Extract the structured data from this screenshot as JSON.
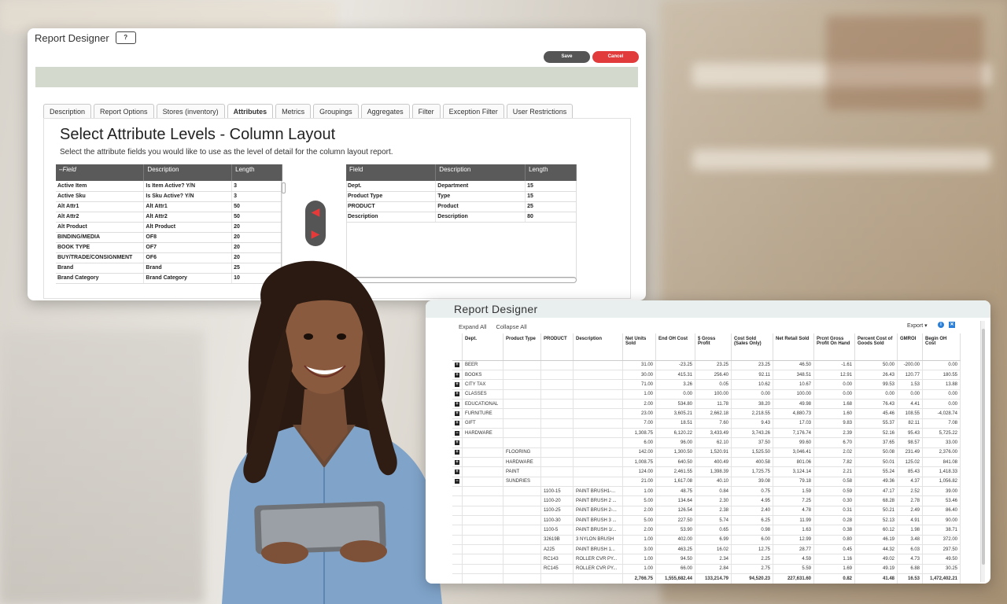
{
  "designer": {
    "title": "Report Designer",
    "help_label": "?",
    "save_label": "Save",
    "cancel_label": "Cancel",
    "tabs": [
      {
        "label": "Description"
      },
      {
        "label": "Report Options"
      },
      {
        "label": "Stores (inventory)"
      },
      {
        "label": "Attributes",
        "active": true
      },
      {
        "label": "Metrics"
      },
      {
        "label": "Groupings"
      },
      {
        "label": "Aggregates"
      },
      {
        "label": "Filter"
      },
      {
        "label": "Exception Filter"
      },
      {
        "label": "User Restrictions"
      }
    ],
    "heading": "Select Attribute Levels - Column Layout",
    "subheading": "Select the attribute fields you would like to use as the level of detail for the column layout report.",
    "available": {
      "columns": [
        "–Field",
        "Description",
        "Length"
      ],
      "rows": [
        [
          "Active Item",
          "Is Item Active? Y/N",
          "3"
        ],
        [
          "Active Sku",
          "Is Sku Active? Y/N",
          "3"
        ],
        [
          "Alt Attr1",
          "Alt Attr1",
          "50"
        ],
        [
          "Alt Attr2",
          "Alt Attr2",
          "50"
        ],
        [
          "Alt Product",
          "Alt Product",
          "20"
        ],
        [
          "BINDING/MEDIA",
          "OF8",
          "20"
        ],
        [
          "BOOK TYPE",
          "OF7",
          "20"
        ],
        [
          "BUY/TRADE/CONSIGNMENT",
          "OF6",
          "20"
        ],
        [
          "Brand",
          "Brand",
          "25"
        ],
        [
          "Brand Category",
          "Brand Category",
          "10"
        ]
      ]
    },
    "selected": {
      "columns": [
        "Field",
        "Description",
        "Length"
      ],
      "rows": [
        [
          "Dept.",
          "Department",
          "15"
        ],
        [
          "Product Type",
          "Type",
          "15"
        ],
        [
          "PRODUCT",
          "Product",
          "25"
        ],
        [
          "Description",
          "Description",
          "80"
        ]
      ]
    },
    "colors": {
      "save": "#555555",
      "cancel": "#e23b3b",
      "header_bar": "#d3d9cd",
      "arrow": "#e63a3a"
    }
  },
  "report": {
    "title": "Report Designer",
    "expand_all": "Expand All",
    "collapse_all": "Collapse All",
    "export_label": "Export ▾",
    "columns": [
      "Dept.",
      "Product Type",
      "PRODUCT",
      "Description",
      "Net Units Sold",
      "End OH Cost",
      "$ Gross Profit",
      "Cost Sold (Sales Only)",
      "Net Retail Sold",
      "Prcnt Gross Profit On Hand",
      "Percent Cost of Goods Sold",
      "GMROI",
      "Begin OH Cost"
    ],
    "rows": [
      {
        "tog": "+",
        "c": [
          "BEER",
          "",
          "",
          "",
          "31.00",
          "-23.25",
          "23.25",
          "23.25",
          "46.50",
          "-1.61",
          "50.00",
          "-200.00",
          "0.00"
        ]
      },
      {
        "tog": "+",
        "c": [
          "BOOKS",
          "",
          "",
          "",
          "30.00",
          "415.31",
          "256.40",
          "92.11",
          "348.51",
          "12.91",
          "26.43",
          "120.77",
          "180.55"
        ]
      },
      {
        "tog": "+",
        "c": [
          "CITY TAX",
          "",
          "",
          "",
          "71.00",
          "3.26",
          "0.05",
          "10.62",
          "10.67",
          "0.00",
          "99.53",
          "1.53",
          "13.88"
        ]
      },
      {
        "tog": "+",
        "c": [
          "CLASSES",
          "",
          "",
          "",
          "1.00",
          "0.00",
          "100.00",
          "0.00",
          "100.00",
          "0.00",
          "0.00",
          "0.00",
          "0.00"
        ]
      },
      {
        "tog": "+",
        "c": [
          "EDUCATIONAL",
          "",
          "",
          "",
          "2.00",
          "534.80",
          "11.78",
          "38.20",
          "49.98",
          "1.68",
          "76.43",
          "4.41",
          "0.00"
        ]
      },
      {
        "tog": "+",
        "c": [
          "FURNITURE",
          "",
          "",
          "",
          "23.00",
          "3,605.21",
          "2,662.18",
          "2,218.55",
          "4,880.73",
          "1.60",
          "45.46",
          "108.55",
          "-4,028.74"
        ]
      },
      {
        "tog": "+",
        "c": [
          "GIFT",
          "",
          "",
          "",
          "7.00",
          "18.51",
          "7.60",
          "9.43",
          "17.03",
          "9.83",
          "55.37",
          "82.11",
          "7.08"
        ]
      },
      {
        "tog": "−",
        "c": [
          "HARDWARE",
          "",
          "",
          "",
          "1,308.75",
          "6,120.22",
          "3,433.49",
          "3,743.26",
          "7,176.74",
          "2.39",
          "52.16",
          "95.43",
          "5,725.22"
        ]
      },
      {
        "tog": "+",
        "c": [
          "",
          "",
          "",
          "",
          "6.00",
          "96.00",
          "62.10",
          "37.50",
          "99.60",
          "6.70",
          "37.65",
          "98.57",
          "33.00"
        ]
      },
      {
        "tog": "+",
        "c": [
          "",
          "FLOORING",
          "",
          "",
          "142.00",
          "1,300.50",
          "1,520.91",
          "1,525.50",
          "3,046.41",
          "2.02",
          "50.08",
          "231.49",
          "2,376.00"
        ]
      },
      {
        "tog": "+",
        "c": [
          "",
          "HARDWARE",
          "",
          "",
          "1,008.75",
          "640.50",
          "400.49",
          "400.58",
          "801.06",
          "7.82",
          "50.01",
          "125.02",
          "841.08"
        ]
      },
      {
        "tog": "+",
        "c": [
          "",
          "PAINT",
          "",
          "",
          "124.00",
          "2,461.55",
          "1,398.39",
          "1,725.75",
          "3,124.14",
          "2.21",
          "55.24",
          "85.43",
          "1,418.33"
        ]
      },
      {
        "tog": "−",
        "c": [
          "",
          "SUNDRIES",
          "",
          "",
          "21.00",
          "1,617.08",
          "40.10",
          "39.08",
          "79.18",
          "0.58",
          "49.36",
          "4.37",
          "1,056.82"
        ]
      },
      {
        "tog": "",
        "c": [
          "",
          "",
          "1100-15",
          "PAINT BRUSH1-...",
          "1.00",
          "48.75",
          "0.84",
          "0.75",
          "1.59",
          "0.59",
          "47.17",
          "2.52",
          "39.00"
        ]
      },
      {
        "tog": "",
        "c": [
          "",
          "",
          "1100-20",
          "PAINT BRUSH 2 ...",
          "5.00",
          "134.64",
          "2.30",
          "4.95",
          "7.25",
          "0.30",
          "68.28",
          "2.78",
          "53.46"
        ]
      },
      {
        "tog": "",
        "c": [
          "",
          "",
          "1100-25",
          "PAINT BRUSH 2-...",
          "2.00",
          "126.54",
          "2.38",
          "2.40",
          "4.78",
          "0.31",
          "50.21",
          "2.49",
          "86.40"
        ]
      },
      {
        "tog": "",
        "c": [
          "",
          "",
          "1100-30",
          "PAINT BRUSH 3 ...",
          "5.00",
          "227.50",
          "5.74",
          "6.25",
          "11.99",
          "0.28",
          "52.13",
          "4.91",
          "90.00"
        ]
      },
      {
        "tog": "",
        "c": [
          "",
          "",
          "1100-5",
          "PAINT BRUSH 1/...",
          "2.00",
          "53.90",
          "0.65",
          "0.98",
          "1.63",
          "0.38",
          "60.12",
          "1.98",
          "38.71"
        ]
      },
      {
        "tog": "",
        "c": [
          "",
          "",
          "32619B",
          "3 NYLON BRUSH",
          "1.00",
          "402.00",
          "6.99",
          "6.00",
          "12.99",
          "0.80",
          "46.19",
          "3.48",
          "372.00"
        ]
      },
      {
        "tog": "",
        "c": [
          "",
          "",
          "A225",
          "PAINT BRUSH 1...",
          "3.00",
          "463.25",
          "16.02",
          "12.75",
          "28.77",
          "0.45",
          "44.32",
          "6.03",
          "297.50"
        ]
      },
      {
        "tog": "",
        "c": [
          "",
          "",
          "RC143",
          "ROLLER CVR PY...",
          "1.00",
          "94.50",
          "2.34",
          "2.25",
          "4.59",
          "1.16",
          "49.02",
          "4.73",
          "49.50"
        ]
      },
      {
        "tog": "",
        "c": [
          "",
          "",
          "RC145",
          "ROLLER CVR PY...",
          "1.00",
          "66.00",
          "2.84",
          "2.75",
          "5.59",
          "1.69",
          "49.19",
          "6.88",
          "30.25"
        ]
      }
    ],
    "totals": [
      "",
      "",
      "",
      "",
      "2,766.75",
      "1,555,682.44",
      "133,214.79",
      "94,520.23",
      "227,631.60",
      "0.82",
      "41.48",
      "16.53",
      "1,472,402.21"
    ]
  }
}
